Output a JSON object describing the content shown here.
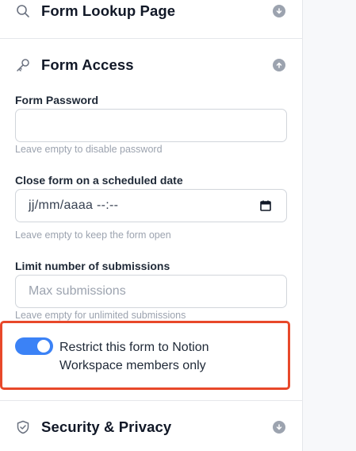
{
  "sections": {
    "lookup": {
      "title": "Form Lookup Page",
      "icon": "search-icon",
      "state_icon": "chevron-down-icon"
    },
    "access": {
      "title": "Form Access",
      "icon": "key-icon",
      "state_icon": "chevron-up-icon"
    },
    "security": {
      "title": "Security & Privacy",
      "icon": "shield-check-icon",
      "state_icon": "chevron-down-icon"
    }
  },
  "fields": {
    "password": {
      "label": "Form Password",
      "value": "",
      "help": "Leave empty to disable password"
    },
    "close_date": {
      "label": "Close form on a scheduled date",
      "value": "jj/mm/aaaa --:--",
      "help": "Leave empty to keep the form open"
    },
    "limit": {
      "label": "Limit number of submissions",
      "placeholder": "Max submissions",
      "help": "Leave empty for unlimited submissions"
    }
  },
  "restrict": {
    "label": "Restrict this form to Notion Workspace members only",
    "enabled": true
  },
  "colors": {
    "accent": "#3b82f6",
    "highlight": "#e8482a",
    "muted": "#9ca3af"
  }
}
